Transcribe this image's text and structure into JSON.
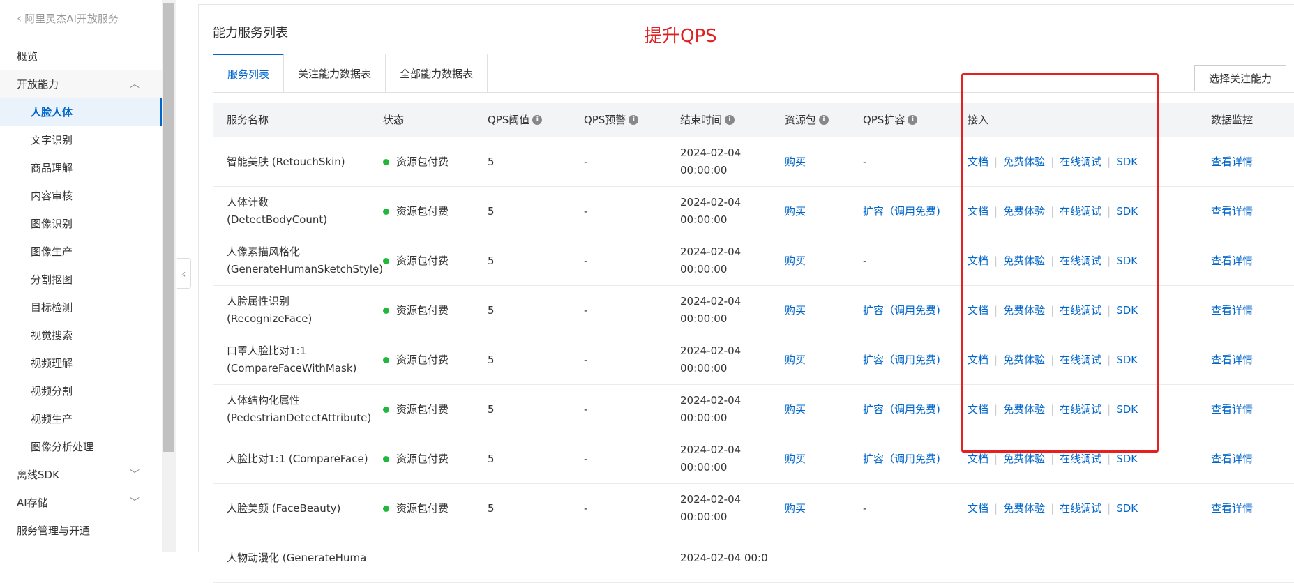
{
  "sidebar": {
    "back_label": "阿里灵杰AI开放服务",
    "items": [
      {
        "label": "概览"
      },
      {
        "label": "开放能力"
      },
      {
        "label": "人脸人体"
      },
      {
        "label": "文字识别"
      },
      {
        "label": "商品理解"
      },
      {
        "label": "内容审核"
      },
      {
        "label": "图像识别"
      },
      {
        "label": "图像生产"
      },
      {
        "label": "分割抠图"
      },
      {
        "label": "目标检测"
      },
      {
        "label": "视觉搜索"
      },
      {
        "label": "视频理解"
      },
      {
        "label": "视频分割"
      },
      {
        "label": "视频生产"
      },
      {
        "label": "图像分析处理"
      },
      {
        "label": "离线SDK"
      },
      {
        "label": "AI存储"
      },
      {
        "label": "服务管理与开通"
      }
    ]
  },
  "main": {
    "title": "能力服务列表",
    "annotation": "提升QPS",
    "tabs": [
      {
        "label": "服务列表"
      },
      {
        "label": "关注能力数据表"
      },
      {
        "label": "全部能力数据表"
      }
    ],
    "select_button": "选择关注能力"
  },
  "table": {
    "columns": [
      "服务名称",
      "状态",
      "QPS阈值",
      "QPS预警",
      "结束时间",
      "资源包",
      "QPS扩容",
      "接入",
      "数据监控"
    ],
    "links": {
      "doc": "文档",
      "trial": "免费体验",
      "debug": "在线调试",
      "sdk": "SDK",
      "detail": "查看详情",
      "buy": "购买"
    },
    "rows": [
      {
        "name": "智能美肤 (RetouchSkin)",
        "status": "资源包付费",
        "qps": "5",
        "warn": "-",
        "end": "2024-02-04 00:00:00",
        "expand": "-"
      },
      {
        "name": "人体计数 (DetectBodyCount)",
        "status": "资源包付费",
        "qps": "5",
        "warn": "-",
        "end": "2024-02-04 00:00:00",
        "expand": "扩容（调用免费)"
      },
      {
        "name": "人像素描风格化 (GenerateHumanSketchStyle)",
        "status": "资源包付费",
        "qps": "5",
        "warn": "-",
        "end": "2024-02-04 00:00:00",
        "expand": "-"
      },
      {
        "name": "人脸属性识别 (RecognizeFace)",
        "status": "资源包付费",
        "qps": "5",
        "warn": "-",
        "end": "2024-02-04 00:00:00",
        "expand": "扩容（调用免费)"
      },
      {
        "name": "口罩人脸比对1:1 (CompareFaceWithMask)",
        "status": "资源包付费",
        "qps": "5",
        "warn": "-",
        "end": "2024-02-04 00:00:00",
        "expand": "扩容（调用免费)"
      },
      {
        "name": "人体结构化属性 (PedestrianDetectAttribute)",
        "status": "资源包付费",
        "qps": "5",
        "warn": "-",
        "end": "2024-02-04 00:00:00",
        "expand": "扩容（调用免费)"
      },
      {
        "name": "人脸比对1:1 (CompareFace)",
        "status": "资源包付费",
        "qps": "5",
        "warn": "-",
        "end": "2024-02-04 00:00:00",
        "expand": "扩容（调用免费)"
      },
      {
        "name": "人脸美颜 (FaceBeauty)",
        "status": "资源包付费",
        "qps": "5",
        "warn": "-",
        "end": "2024-02-04 00:00:00",
        "expand": "-"
      },
      {
        "name": "人物动漫化 (GenerateHuma",
        "status": "",
        "qps": "",
        "warn": "",
        "end": "2024-02-04 00:0",
        "expand": ""
      }
    ]
  }
}
